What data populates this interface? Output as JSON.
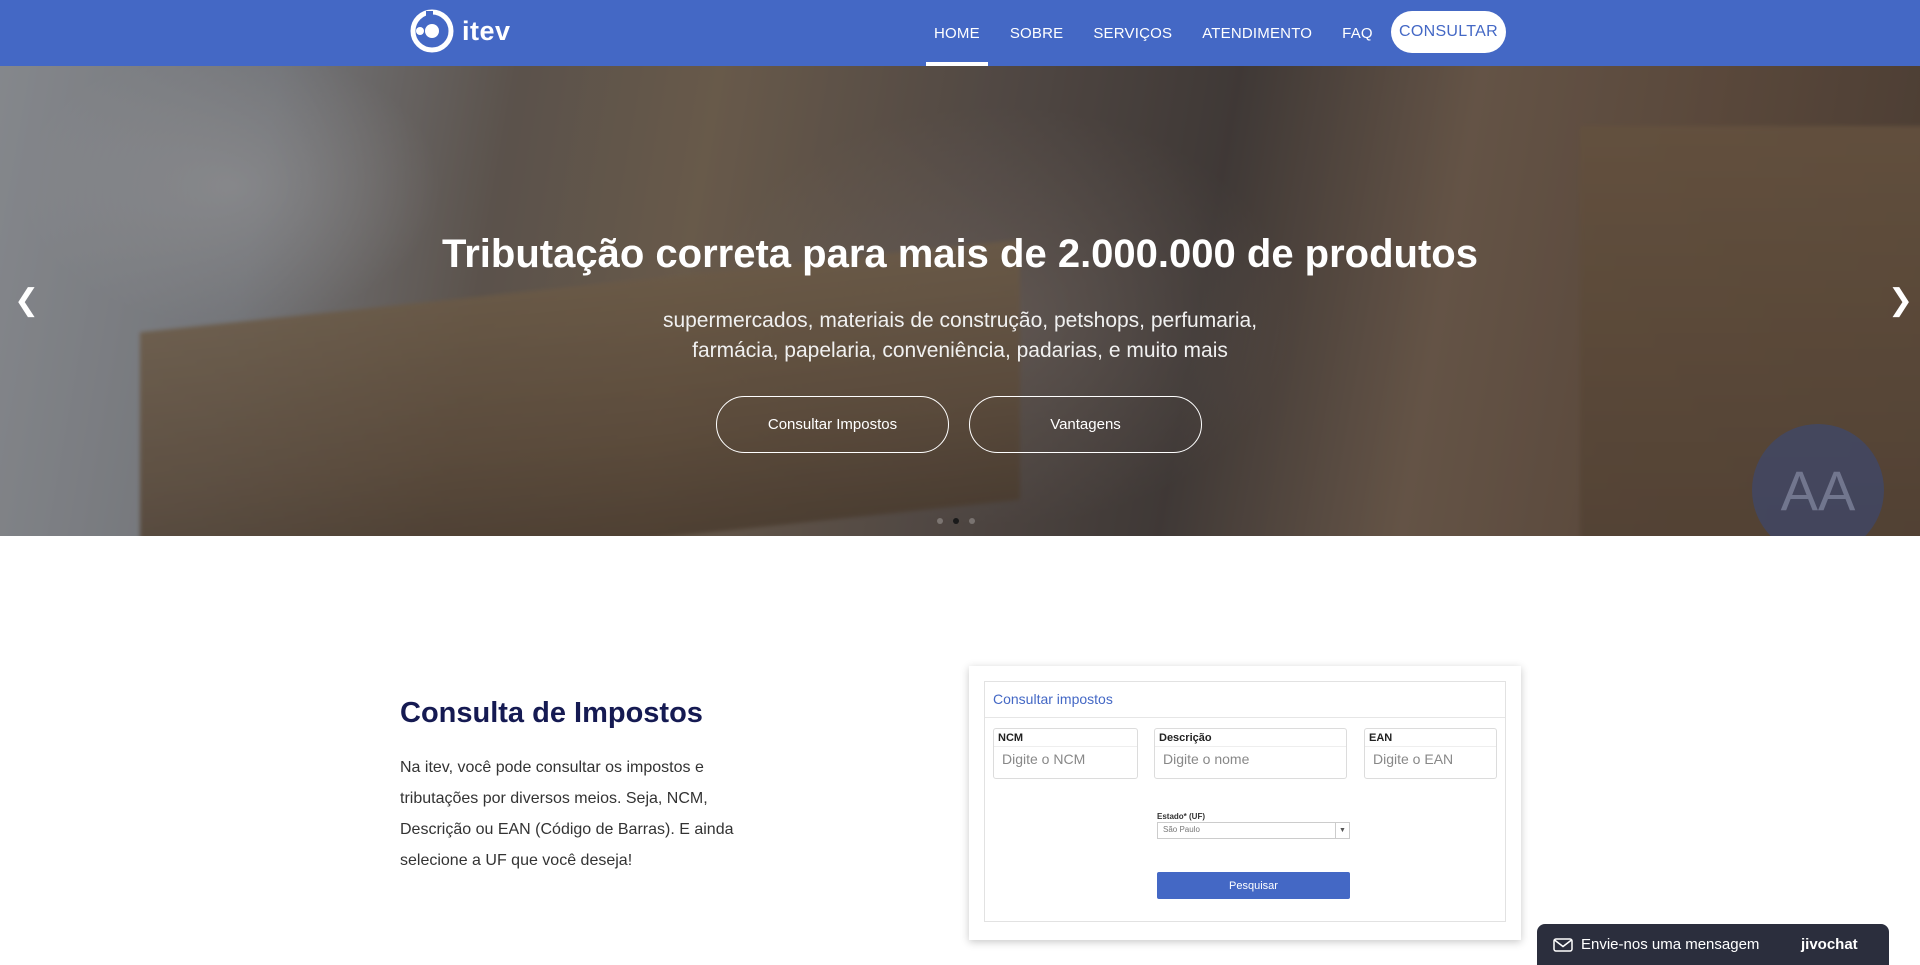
{
  "brand": {
    "name": "itev",
    "color": "#4468c5"
  },
  "nav": {
    "items": [
      {
        "label": "HOME",
        "active": true
      },
      {
        "label": "SOBRE",
        "active": false
      },
      {
        "label": "SERVIÇOS",
        "active": false
      },
      {
        "label": "ATENDIMENTO",
        "active": false
      },
      {
        "label": "FAQ",
        "active": false
      }
    ],
    "cta_label": "CONSULTAR"
  },
  "hero": {
    "title": "Tributação correta para mais de 2.000.000 de produtos",
    "subtitle_line1": "supermercados, materiais de construção, petshops, perfumaria,",
    "subtitle_line2": "farmácia, papelaria, conveniência, padarias, e muito mais",
    "buttons": [
      "Consultar Impostos",
      "Vantagens"
    ],
    "watermark_text": "AA",
    "carousel": {
      "slide_count": 3,
      "active_index": 1,
      "prev_icon": "chevron-left-icon",
      "next_icon": "chevron-right-icon"
    }
  },
  "consulta": {
    "title": "Consulta de Impostos",
    "text": "Na itev, você pode consultar os impostos e tributações por diversos meios. Seja, NCM, Descrição ou EAN (Código de Barras). E ainda selecione a UF que você deseja!"
  },
  "mock_form": {
    "heading": "Consultar impostos",
    "fields": [
      {
        "label": "NCM",
        "placeholder": "Digite o NCM"
      },
      {
        "label": "Descrição",
        "placeholder": "Digite o nome"
      },
      {
        "label": "EAN",
        "placeholder": "Digite o EAN"
      }
    ],
    "uf_label": "Estado* (UF)",
    "uf_value": "São Paulo",
    "submit_label": "Pesquisar"
  },
  "chat": {
    "label": "Envie-nos uma mensagem",
    "brand": "jivochat",
    "icon": "envelope-icon"
  }
}
